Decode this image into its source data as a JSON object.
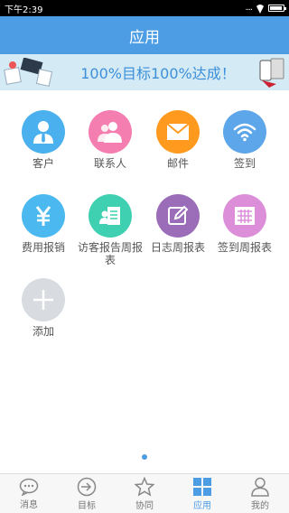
{
  "status_bar": {
    "time": "下午2:39",
    "signal": "....",
    "battery_level": 0.9
  },
  "header": {
    "title": "应用"
  },
  "banner": {
    "text": "100%目标100%达成！"
  },
  "apps": [
    {
      "label": "客户",
      "icon": "customer-icon",
      "color": "#4bb0ee"
    },
    {
      "label": "联系人",
      "icon": "contacts-icon",
      "color": "#f57eb0"
    },
    {
      "label": "邮件",
      "icon": "mail-icon",
      "color": "#ff9a1f"
    },
    {
      "label": "签到",
      "icon": "wifi-icon",
      "color": "#5ea6ea"
    },
    {
      "label": "费用报销",
      "icon": "yen-icon",
      "color": "#4bb8ef"
    },
    {
      "label": "访客报告周报表",
      "icon": "visitor-report-icon",
      "color": "#3fd0b2"
    },
    {
      "label": "日志周报表",
      "icon": "log-report-icon",
      "color": "#9b6cb8"
    },
    {
      "label": "签到周报表",
      "icon": "checkin-report-icon",
      "color": "#dc8ed9"
    },
    {
      "label": "添加",
      "icon": "add-icon",
      "color": "#d8dce1"
    }
  ],
  "tabs": [
    {
      "label": "消息",
      "icon": "message-icon",
      "active": false
    },
    {
      "label": "目标",
      "icon": "target-icon",
      "active": false
    },
    {
      "label": "协同",
      "icon": "star-icon",
      "active": false
    },
    {
      "label": "应用",
      "icon": "apps-grid-icon",
      "active": true
    },
    {
      "label": "我的",
      "icon": "person-icon",
      "active": false
    }
  ]
}
